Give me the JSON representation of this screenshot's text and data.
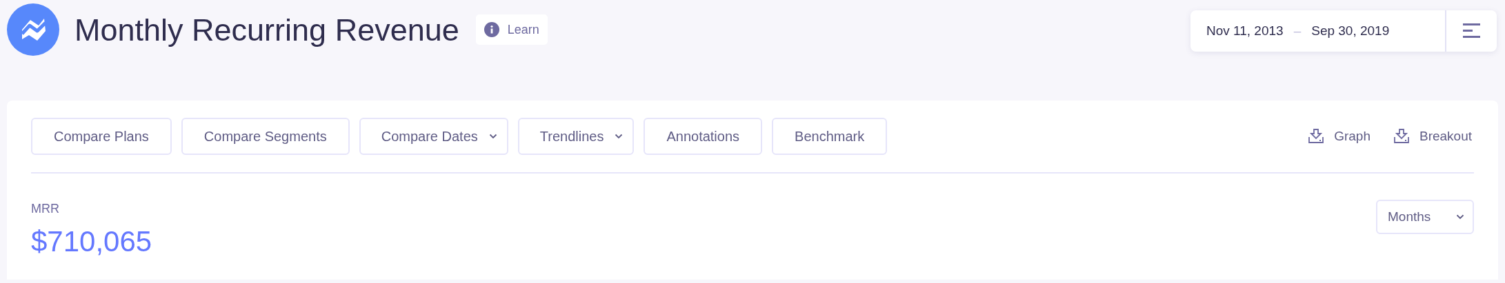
{
  "header": {
    "title": "Monthly Recurring Revenue",
    "learn_button": "Learn",
    "date_range": {
      "start": "Nov 11, 2013",
      "separator": "–",
      "end": "Sep 30, 2019"
    }
  },
  "toolbar": {
    "buttons": [
      {
        "label": "Compare Plans",
        "has_menu": false
      },
      {
        "label": "Compare Segments",
        "has_menu": false
      },
      {
        "label": "Compare Dates",
        "has_menu": true
      },
      {
        "label": "Trendlines",
        "has_menu": true
      },
      {
        "label": "Annotations",
        "has_menu": false
      },
      {
        "label": "Benchmark",
        "has_menu": false
      }
    ],
    "exports": [
      "Graph",
      "Breakout"
    ]
  },
  "metric": {
    "label": "MRR",
    "value": "$710,065",
    "interval": "Months"
  }
}
